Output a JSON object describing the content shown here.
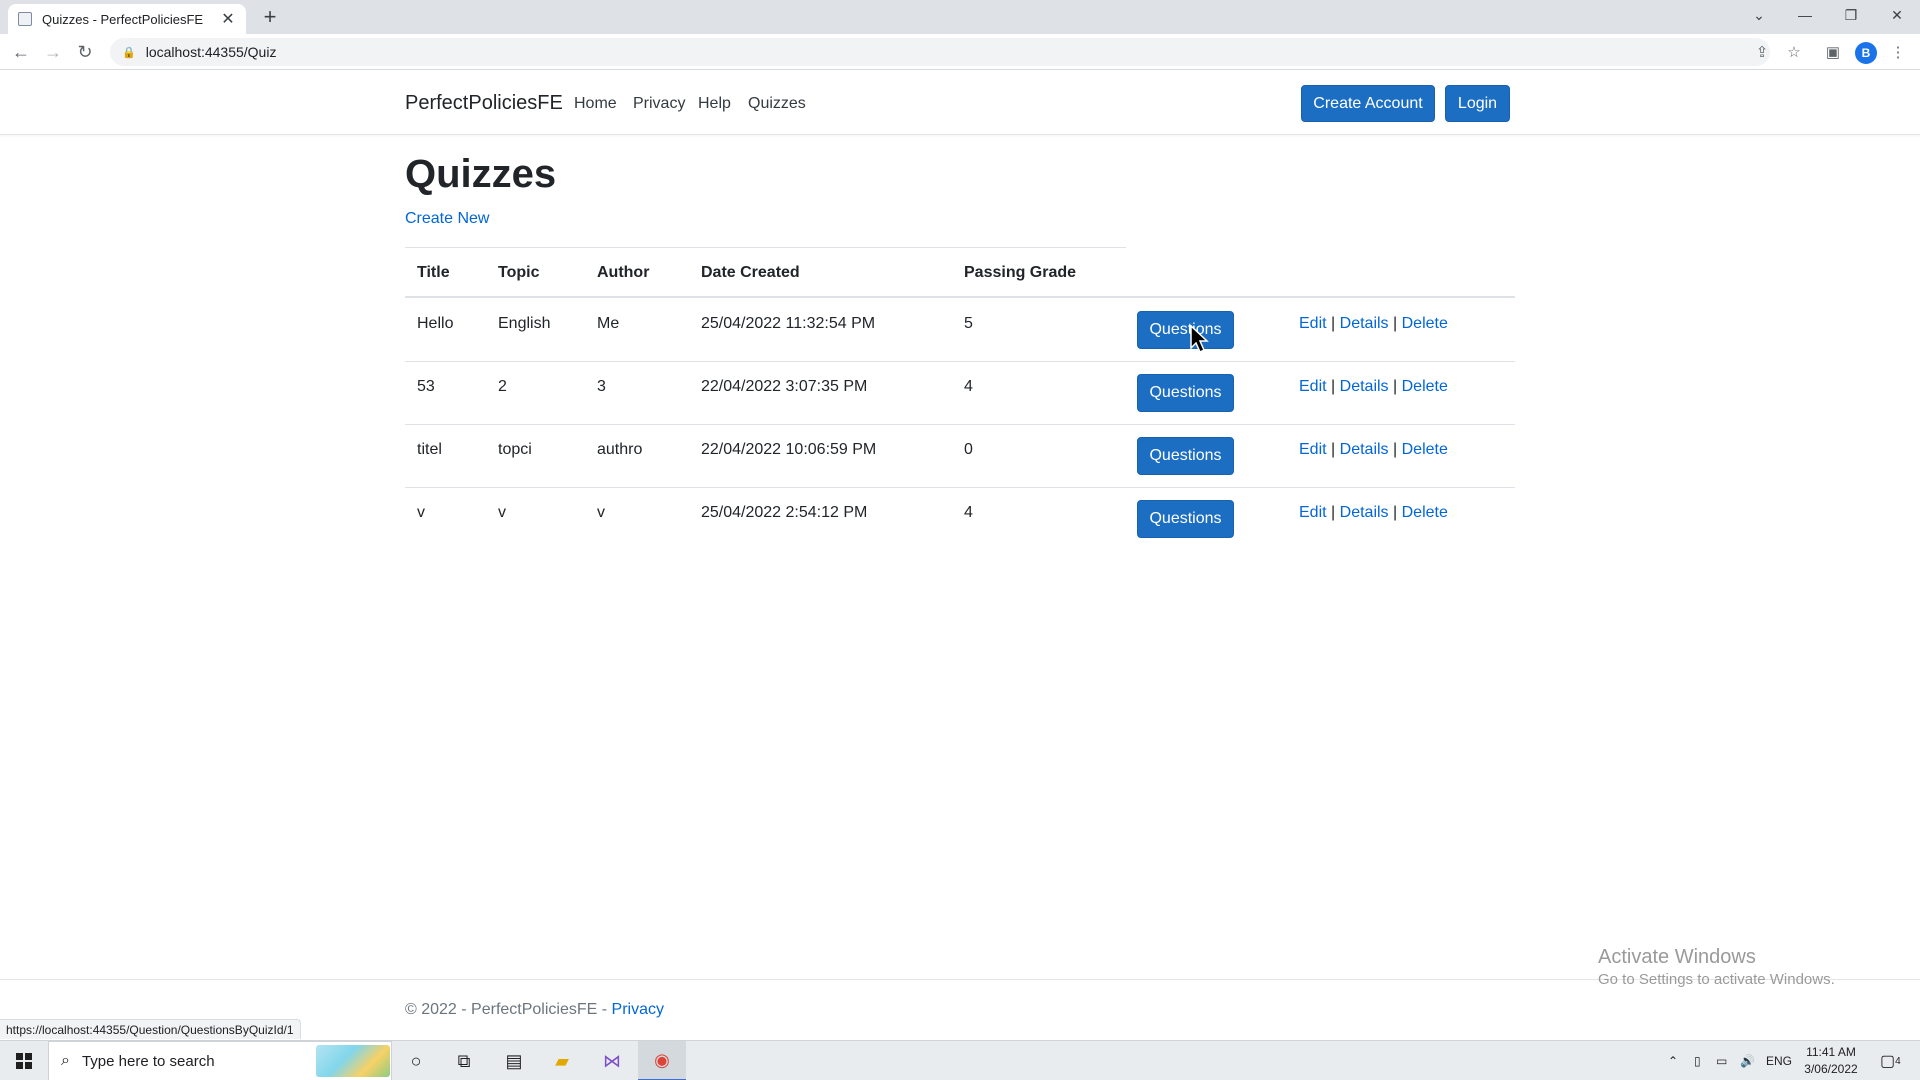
{
  "browser": {
    "tab_title": "Quizzes - PerfectPoliciesFE",
    "new_tab_symbol": "+",
    "url": "localhost:44355/Quiz",
    "profile_initial": "B",
    "status_url": "https://localhost:44355/Question/QuestionsByQuizId/1"
  },
  "navbar": {
    "brand": "PerfectPoliciesFE",
    "links": [
      "Home",
      "Privacy",
      "Help",
      "Quizzes"
    ],
    "create_account": "Create Account",
    "login": "Login"
  },
  "page": {
    "title": "Quizzes",
    "create_new": "Create New"
  },
  "table": {
    "headers": [
      "Title",
      "Topic",
      "Author",
      "Date Created",
      "Passing Grade"
    ],
    "rows": [
      {
        "title": "Hello",
        "topic": "English",
        "author": "Me",
        "date": "25/04/2022 11:32:54 PM",
        "grade": "5"
      },
      {
        "title": "53",
        "topic": "2",
        "author": "3",
        "date": "22/04/2022 3:07:35 PM",
        "grade": "4"
      },
      {
        "title": "titel",
        "topic": "topci",
        "author": "authro",
        "date": "22/04/2022 10:06:59 PM",
        "grade": "0"
      },
      {
        "title": "v",
        "topic": "v",
        "author": "v",
        "date": "25/04/2022 2:54:12 PM",
        "grade": "4"
      }
    ],
    "questions_label": "Questions",
    "edit_label": "Edit",
    "details_label": "Details",
    "delete_label": "Delete",
    "separator": "|"
  },
  "footer": {
    "text": "© 2022 - PerfectPoliciesFE - ",
    "privacy": "Privacy"
  },
  "watermark": {
    "line1": "Activate Windows",
    "line2": "Go to Settings to activate Windows."
  },
  "taskbar": {
    "search_placeholder": "Type here to search",
    "language": "ENG",
    "time": "11:41 AM",
    "date": "3/06/2022",
    "notification_count": "4"
  },
  "colors": {
    "primary": "#1b6ec2",
    "link": "#0366d6"
  }
}
